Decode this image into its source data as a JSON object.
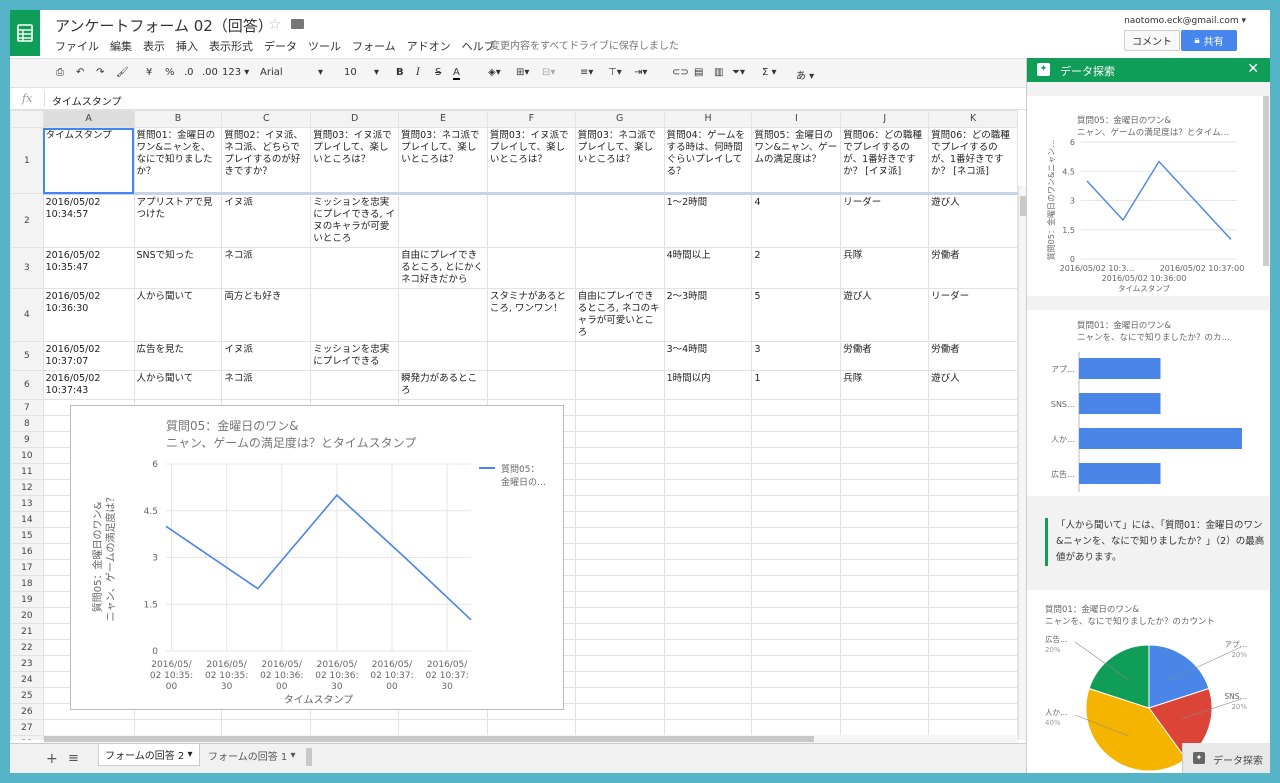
{
  "app": {
    "doc_title": "アンケートフォーム 02（回答）",
    "save_status": "変更内容をすべてドライブに保存しました",
    "user_email": "naotomo.eck@gmail.com",
    "comment_label": "コメント",
    "share_label": "共有"
  },
  "menu": [
    "ファイル",
    "編集",
    "表示",
    "挿入",
    "表示形式",
    "データ",
    "ツール",
    "フォーム",
    "アドオン",
    "ヘルプ"
  ],
  "toolbar": {
    "currency": "¥",
    "percent": "%",
    "dec_less": ".0",
    "dec_more": ".00",
    "more_formats": "123",
    "font": "Arial",
    "font_size": "10",
    "bold": "B",
    "italic": "I",
    "strike": "S",
    "text_color": "A",
    "sigma": "Σ",
    "input_tools": "あ"
  },
  "formula_bar": {
    "label": "fx",
    "value": "タイムスタンプ"
  },
  "grid": {
    "columns": [
      "A",
      "B",
      "C",
      "D",
      "E",
      "F",
      "G",
      "H",
      "I",
      "J",
      "K"
    ],
    "rows": [
      {
        "n": "1",
        "cells": [
          "タイムスタンプ",
          "質問01：金曜日のワン&ニャンを、なにで知りましたか？",
          "質問02：イヌ派、ネコ派、どちらでプレイするのが好きですか？",
          "質問03：イヌ派でプレイして、楽しいところは？",
          "質問03：ネコ派でプレイして、楽しいところは？",
          "質問03：イヌ派でプレイして、楽しいところは？",
          "質問03：ネコ派でプレイして、楽しいところは？",
          "質問04：ゲームをする時は、何時間ぐらいプレイしてる？",
          "質問05：金曜日のワン&ニャン、ゲームの満足度は？",
          "質問06：どの職種でプレイするのが、1番好きですか？ [イヌ派]",
          "質問06：どの職種でプレイするのが、1番好きですか？ [ネコ派]"
        ]
      },
      {
        "n": "2",
        "cells": [
          "2016/05/02 10:34:57",
          "アプリストアで見つけた",
          "イヌ派",
          "ミッションを忠実にプレイできる, イヌのキャラが可愛いところ",
          "",
          "",
          "",
          "1〜2時間",
          "4",
          "リーダー",
          "遊び人"
        ]
      },
      {
        "n": "3",
        "cells": [
          "2016/05/02 10:35:47",
          "SNSで知った",
          "ネコ派",
          "",
          "自由にプレイできるところ, とにかくネコ好きだから",
          "",
          "",
          "4時間以上",
          "2",
          "兵隊",
          "労働者"
        ]
      },
      {
        "n": "4",
        "cells": [
          "2016/05/02 10:36:30",
          "人から聞いて",
          "両方とも好き",
          "",
          "",
          "スタミナがあるところ, ワンワン！",
          "自由にプレイできるところ, ネコのキャラが可愛いところ",
          "2〜3時間",
          "5",
          "遊び人",
          "リーダー"
        ]
      },
      {
        "n": "5",
        "cells": [
          "2016/05/02 10:37:07",
          "広告を見た",
          "イヌ派",
          "ミッションを忠実にプレイできる",
          "",
          "",
          "",
          "3〜4時間",
          "3",
          "労働者",
          "労働者"
        ]
      },
      {
        "n": "6",
        "cells": [
          "2016/05/02 10:37:43",
          "人から聞いて",
          "ネコ派",
          "",
          "瞬発力があるところ",
          "",
          "",
          "1時間以内",
          "1",
          "兵隊",
          "遊び人"
        ]
      }
    ],
    "empty_rows": [
      "7",
      "8",
      "9",
      "10",
      "11",
      "12",
      "13",
      "14",
      "15",
      "16",
      "17",
      "18",
      "19",
      "20",
      "21",
      "22",
      "23",
      "24",
      "25",
      "26",
      "27",
      "28"
    ]
  },
  "chart_data": [
    {
      "type": "line",
      "title": "質問05：金曜日のワン&ニャン、ゲームの満足度は？とタイムスタンプ",
      "title_lines": [
        "質問05：金曜日のワン&",
        "ニャン、ゲームの満足度は？とタイムスタンプ"
      ],
      "xlabel": "タイムスタンプ",
      "ylabel_lines": [
        "質問05：金曜日のワン&",
        "ニャン、ゲームの満足度は？"
      ],
      "x": [
        "2016/05/02 10:34:57",
        "2016/05/02 10:35:47",
        "2016/05/02 10:36:30",
        "2016/05/02 10:37:07",
        "2016/05/02 10:37:43"
      ],
      "xtick_labels": [
        [
          "2016/05/",
          "02 10:35:",
          "00"
        ],
        [
          "2016/05/",
          "02 10:35:",
          "30"
        ],
        [
          "2016/05/",
          "02 10:36:",
          "00"
        ],
        [
          "2016/05/",
          "02 10:36:",
          "30"
        ],
        [
          "2016/05/",
          "02 10:37:",
          "00"
        ],
        [
          "2016/05/",
          "02 10:37:",
          "30"
        ]
      ],
      "ytick_labels": [
        "0",
        "1.5",
        "3",
        "4.5",
        "6"
      ],
      "ylim": [
        0,
        6
      ],
      "series": [
        {
          "name": "質問05：金曜日の…",
          "values": [
            4,
            2,
            5,
            3,
            1
          ]
        }
      ],
      "legend_lines": [
        "質問05：",
        "金曜日の…"
      ],
      "legend": "right",
      "color": "#4a86e8"
    },
    {
      "type": "line",
      "title_lines": [
        "質問05：金曜日のワン&",
        "ニャン、ゲームの満足度は？とタイム…"
      ],
      "ylabel": "質問05：金曜日のワン&ニャン…",
      "xlabel": "タイムスタンプ",
      "xtick_labels": [
        "2016/05/02 10:3…",
        "2016/05/02 10:37:00"
      ],
      "xtick_label_mid": "2016/05/02 10:36:00",
      "ytick_labels": [
        "0",
        "1.5",
        "3",
        "4.5",
        "6"
      ],
      "ylim": [
        0,
        6
      ],
      "series": [
        {
          "values": [
            4,
            2,
            5,
            3,
            1
          ]
        }
      ],
      "color": "#4a86e8"
    },
    {
      "type": "bar",
      "title_lines": [
        "質問01：金曜日のワン&",
        "ニャンを、なにで知りましたか？のカ…"
      ],
      "categories": [
        "アプ…",
        "SNS…",
        "人か…",
        "広告…"
      ],
      "values": [
        1,
        1,
        2,
        1
      ],
      "color": "#4a86e8"
    },
    {
      "type": "pie",
      "title_lines": [
        "質問01：金曜日のワン&",
        "ニャンを、なにで知りましたか？のカウント"
      ],
      "slices": [
        {
          "label": "アプ…",
          "value": 20,
          "pct_label": "20%",
          "color": "#4a86e8"
        },
        {
          "label": "SNS…",
          "value": 20,
          "pct_label": "20%",
          "color": "#db4437"
        },
        {
          "label": "人か…",
          "value": 40,
          "pct_label": "40%",
          "color": "#f4b400"
        },
        {
          "label": "広告…",
          "value": 20,
          "pct_label": "20%",
          "color": "#0f9d58"
        }
      ]
    }
  ],
  "panel": {
    "title": "データ探索",
    "insight": "「人から聞いて」には、「質問01：金曜日のワン&ニャンを、なにで知りましたか？」（2）の最高値があります。",
    "footer_label": "データ探索"
  },
  "sheets": {
    "tabs": [
      "フォームの回答 2",
      "フォームの回答 1"
    ]
  },
  "colors": {
    "brand_green": "#0f9d58",
    "share_blue": "#4787ed",
    "selection_blue": "#4285f4"
  }
}
